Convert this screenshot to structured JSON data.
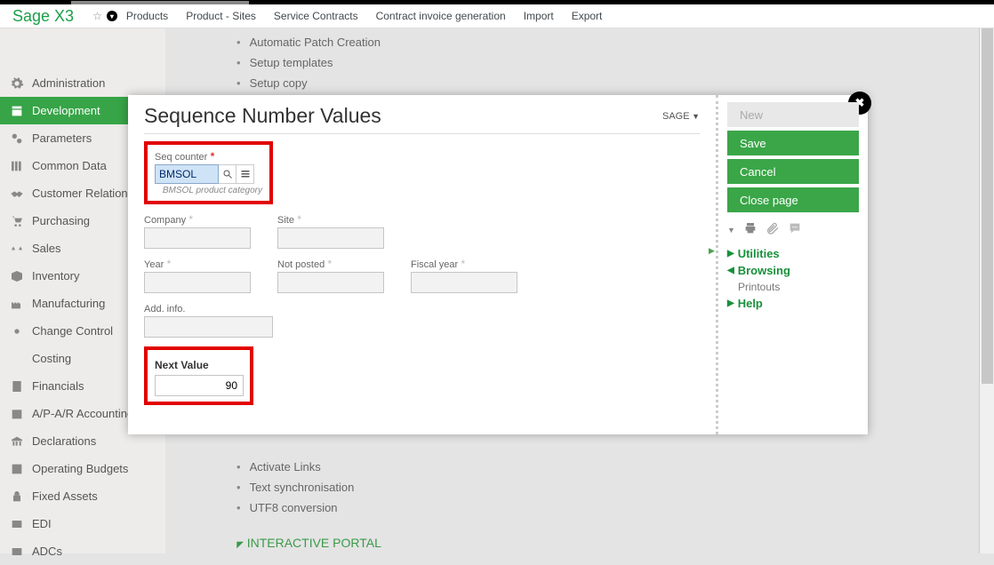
{
  "header": {
    "logo": "Sage X3",
    "links": [
      "Products",
      "Product - Sites",
      "Service Contracts",
      "Contract invoice generation",
      "Import",
      "Export"
    ]
  },
  "sidebar": {
    "items": [
      {
        "label": "Administration"
      },
      {
        "label": "Development",
        "active": true
      },
      {
        "label": "Parameters"
      },
      {
        "label": "Common Data"
      },
      {
        "label": "Customer Relation"
      },
      {
        "label": "Purchasing"
      },
      {
        "label": "Sales"
      },
      {
        "label": "Inventory"
      },
      {
        "label": "Manufacturing"
      },
      {
        "label": "Change Control"
      },
      {
        "label": "Costing"
      },
      {
        "label": "Financials"
      },
      {
        "label": "A/P-A/R Accounting"
      },
      {
        "label": "Declarations"
      },
      {
        "label": "Operating Budgets"
      },
      {
        "label": "Fixed Assets"
      },
      {
        "label": "EDI"
      },
      {
        "label": "ADCs"
      }
    ]
  },
  "background": {
    "top_items": [
      "Automatic Patch Creation",
      "Setup templates",
      "Setup copy"
    ],
    "mid_items": [
      "Activate Links",
      "Text synchronisation",
      "UTF8 conversion"
    ],
    "section": "INTERACTIVE PORTAL"
  },
  "modal": {
    "title": "Sequence Number Values",
    "dropdown": "SAGE",
    "seq_label": "Seq counter",
    "seq_value": "BMSOL",
    "seq_help": "BMSOL product category",
    "fields": {
      "company": "Company",
      "site": "Site",
      "year": "Year",
      "not_posted": "Not posted",
      "fiscal_year": "Fiscal year",
      "add_info": "Add. info."
    },
    "next_header": "Next Value",
    "next_value": "90",
    "actions": {
      "new": "New",
      "save": "Save",
      "cancel": "Cancel",
      "close": "Close page"
    },
    "right_links": {
      "utilities": "Utilities",
      "browsing": "Browsing",
      "printouts": "Printouts",
      "help": "Help"
    }
  }
}
